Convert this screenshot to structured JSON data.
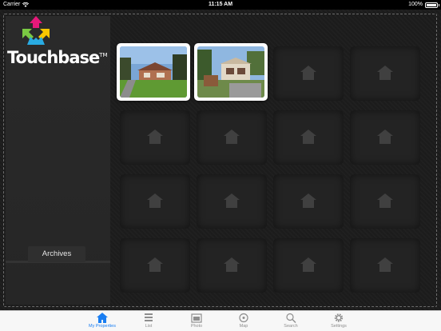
{
  "status_bar": {
    "carrier": "Carrier",
    "time": "11:15 AM",
    "battery": "100%"
  },
  "brand": {
    "name": "Touchbase",
    "trademark": "TM"
  },
  "sidebar": {
    "archives_label": "Archives"
  },
  "properties": [
    {
      "icon": "house-photo-1"
    },
    {
      "icon": "house-photo-2"
    }
  ],
  "tabbar": {
    "items": [
      {
        "label": "My Properties",
        "icon": "home-icon",
        "active": true
      },
      {
        "label": "List",
        "icon": "list-icon",
        "active": false
      },
      {
        "label": "Photo",
        "icon": "photo-icon",
        "active": false
      },
      {
        "label": "Map",
        "icon": "map-icon",
        "active": false
      },
      {
        "label": "Search",
        "icon": "search-icon",
        "active": false
      },
      {
        "label": "Settings",
        "icon": "gear-icon",
        "active": false
      }
    ]
  },
  "colors": {
    "accent": "#1a7ef2",
    "background": "#1c1c1c"
  }
}
